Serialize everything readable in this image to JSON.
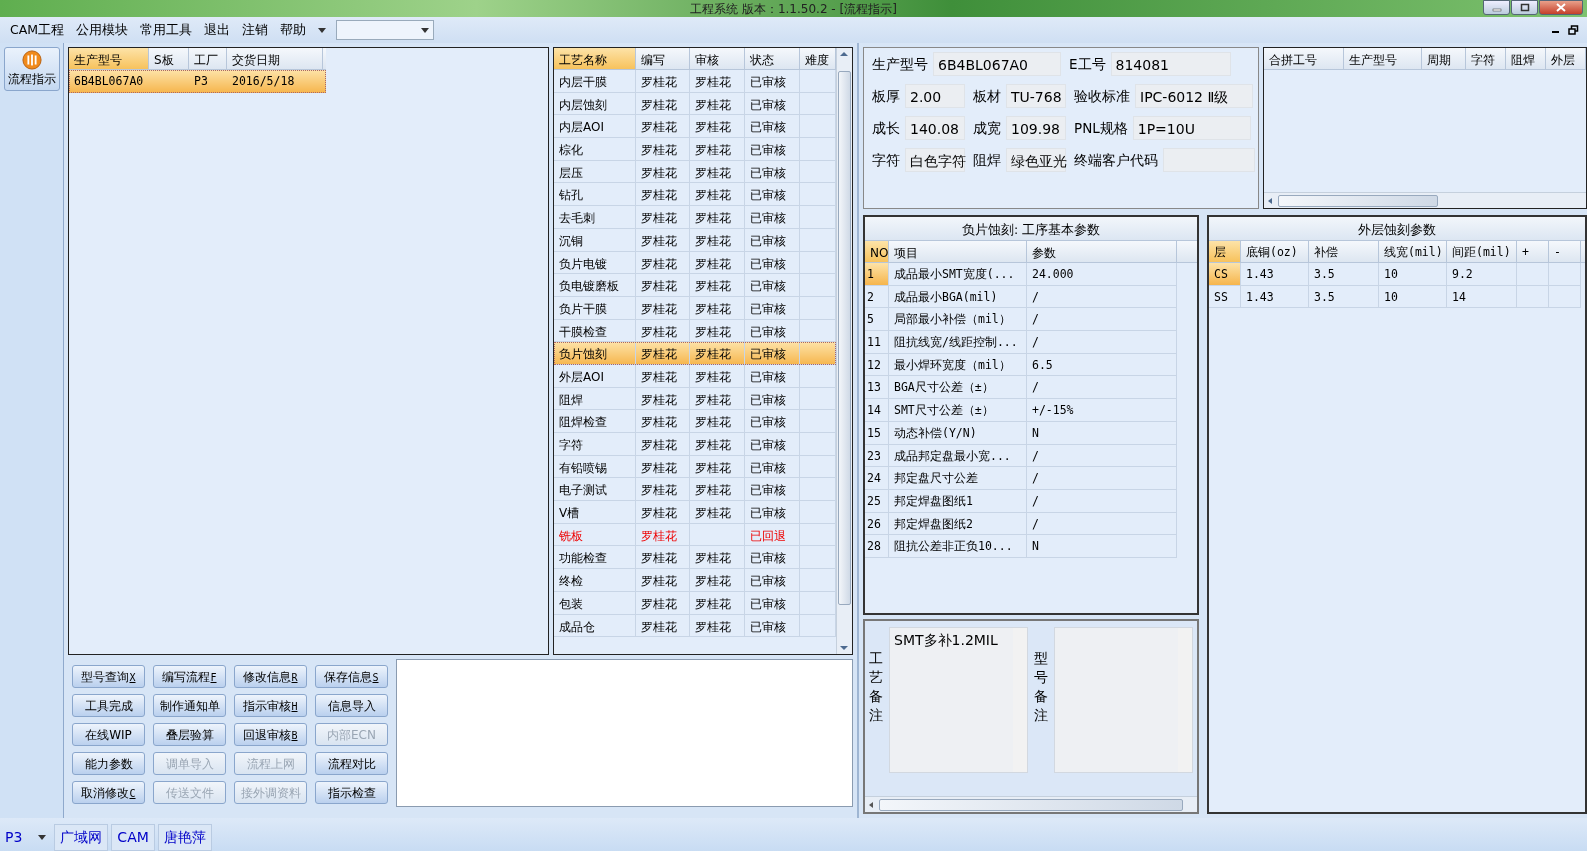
{
  "window": {
    "title": "工程系统   版本：1.1.50.2 - [流程指示]"
  },
  "menu": {
    "items": [
      "CAM工程",
      "公用模块",
      "常用工具",
      "退出",
      "注销",
      "帮助"
    ]
  },
  "sidebar": {
    "button": "流程指示"
  },
  "model_list": {
    "columns": [
      "生产型号",
      "S板",
      "工厂",
      "交货日期"
    ],
    "rows": [
      {
        "model": "6B4BL067A0",
        "factory": "P3",
        "date": "2016/5/18",
        "selected": true
      }
    ]
  },
  "process_table": {
    "columns": [
      "工艺名称",
      "编写",
      "审核",
      "状态",
      "难度"
    ],
    "rows": [
      {
        "name": "内层干膜",
        "writer": "罗桂花",
        "reviewer": "罗桂花",
        "status": "已审核",
        "selected": false,
        "rejected": false
      },
      {
        "name": "内层蚀刻",
        "writer": "罗桂花",
        "reviewer": "罗桂花",
        "status": "已审核",
        "selected": false,
        "rejected": false
      },
      {
        "name": "内层AOI",
        "writer": "罗桂花",
        "reviewer": "罗桂花",
        "status": "已审核",
        "selected": false,
        "rejected": false
      },
      {
        "name": "棕化",
        "writer": "罗桂花",
        "reviewer": "罗桂花",
        "status": "已审核",
        "selected": false,
        "rejected": false
      },
      {
        "name": "层压",
        "writer": "罗桂花",
        "reviewer": "罗桂花",
        "status": "已审核",
        "selected": false,
        "rejected": false
      },
      {
        "name": "钻孔",
        "writer": "罗桂花",
        "reviewer": "罗桂花",
        "status": "已审核",
        "selected": false,
        "rejected": false
      },
      {
        "name": "去毛刺",
        "writer": "罗桂花",
        "reviewer": "罗桂花",
        "status": "已审核",
        "selected": false,
        "rejected": false
      },
      {
        "name": "沉铜",
        "writer": "罗桂花",
        "reviewer": "罗桂花",
        "status": "已审核",
        "selected": false,
        "rejected": false
      },
      {
        "name": "负片电镀",
        "writer": "罗桂花",
        "reviewer": "罗桂花",
        "status": "已审核",
        "selected": false,
        "rejected": false
      },
      {
        "name": "负电镀磨板",
        "writer": "罗桂花",
        "reviewer": "罗桂花",
        "status": "已审核",
        "selected": false,
        "rejected": false
      },
      {
        "name": "负片干膜",
        "writer": "罗桂花",
        "reviewer": "罗桂花",
        "status": "已审核",
        "selected": false,
        "rejected": false
      },
      {
        "name": "干膜检查",
        "writer": "罗桂花",
        "reviewer": "罗桂花",
        "status": "已审核",
        "selected": false,
        "rejected": false
      },
      {
        "name": "负片蚀刻",
        "writer": "罗桂花",
        "reviewer": "罗桂花",
        "status": "已审核",
        "selected": true,
        "rejected": false
      },
      {
        "name": "外层AOI",
        "writer": "罗桂花",
        "reviewer": "罗桂花",
        "status": "已审核",
        "selected": false,
        "rejected": false
      },
      {
        "name": "阻焊",
        "writer": "罗桂花",
        "reviewer": "罗桂花",
        "status": "已审核",
        "selected": false,
        "rejected": false
      },
      {
        "name": "阻焊检查",
        "writer": "罗桂花",
        "reviewer": "罗桂花",
        "status": "已审核",
        "selected": false,
        "rejected": false
      },
      {
        "name": "字符",
        "writer": "罗桂花",
        "reviewer": "罗桂花",
        "status": "已审核",
        "selected": false,
        "rejected": false
      },
      {
        "name": "有铅喷锡",
        "writer": "罗桂花",
        "reviewer": "罗桂花",
        "status": "已审核",
        "selected": false,
        "rejected": false
      },
      {
        "name": "电子测试",
        "writer": "罗桂花",
        "reviewer": "罗桂花",
        "status": "已审核",
        "selected": false,
        "rejected": false
      },
      {
        "name": "V槽",
        "writer": "罗桂花",
        "reviewer": "罗桂花",
        "status": "已审核",
        "selected": false,
        "rejected": false
      },
      {
        "name": "铣板",
        "writer": "罗桂花",
        "status": "已回退",
        "selected": false,
        "rejected": true
      },
      {
        "name": "功能检查",
        "writer": "罗桂花",
        "reviewer": "罗桂花",
        "status": "已审核",
        "selected": false,
        "rejected": false
      },
      {
        "name": "终检",
        "writer": "罗桂花",
        "reviewer": "罗桂花",
        "status": "已审核",
        "selected": false,
        "rejected": false
      },
      {
        "name": "包装",
        "writer": "罗桂花",
        "reviewer": "罗桂花",
        "status": "已审核",
        "selected": false,
        "rejected": false
      },
      {
        "name": "成品仓",
        "writer": "罗桂花",
        "reviewer": "罗桂花",
        "status": "已审核",
        "selected": false,
        "rejected": false
      }
    ]
  },
  "actions": [
    {
      "label": "型号查询",
      "shortcut": "X",
      "disabled": false
    },
    {
      "label": "编写流程",
      "shortcut": "F",
      "disabled": false
    },
    {
      "label": "修改信息",
      "shortcut": "R",
      "disabled": false
    },
    {
      "label": "保存信息",
      "shortcut": "S",
      "disabled": false
    },
    {
      "label": "工具完成",
      "disabled": false
    },
    {
      "label": "制作通知单",
      "disabled": false
    },
    {
      "label": "指示审核",
      "shortcut": "H",
      "disabled": false
    },
    {
      "label": "信息导入",
      "disabled": false
    },
    {
      "label": "在线WIP",
      "disabled": false
    },
    {
      "label": "叠层验算",
      "disabled": false
    },
    {
      "label": "回退审核",
      "shortcut": "B",
      "disabled": false
    },
    {
      "label": "内部ECN",
      "disabled": true
    },
    {
      "label": "能力参数",
      "disabled": false
    },
    {
      "label": "调单导入",
      "disabled": true
    },
    {
      "label": "流程上网",
      "disabled": true
    },
    {
      "label": "流程对比",
      "disabled": false
    },
    {
      "label": "取消修改",
      "shortcut": "C",
      "disabled": false
    },
    {
      "label": "传送文件",
      "disabled": true
    },
    {
      "label": "接外调资料",
      "disabled": true
    },
    {
      "label": "指示检查",
      "disabled": false
    }
  ],
  "info": {
    "rows": [
      {
        "fields": [
          {
            "label": "生产型号",
            "value": "6B4BL067A0"
          },
          {
            "label": "E工号",
            "value": "814081"
          }
        ]
      },
      {
        "fields": [
          {
            "label": "板厚",
            "value": "2.00"
          },
          {
            "label": "板材",
            "value": "TU-768"
          },
          {
            "label": "验收标准",
            "value": "IPC-6012 Ⅱ级"
          }
        ]
      },
      {
        "fields": [
          {
            "label": "成长",
            "value": "140.08"
          },
          {
            "label": "成宽",
            "value": "109.98"
          },
          {
            "label": "PNL规格",
            "value": "1P=10U"
          }
        ]
      },
      {
        "fields": [
          {
            "label": "字符",
            "value": "白色字符"
          },
          {
            "label": "阻焊",
            "value": "绿色亚光"
          },
          {
            "label": "终端客户代码"
          }
        ]
      }
    ]
  },
  "combine_list": {
    "columns": [
      "合拼工号",
      "生产型号",
      "周期",
      "字符",
      "阻焊",
      "外层"
    ]
  },
  "process_params": {
    "title": "负片蚀刻: 工序基本参数",
    "columns": [
      "NO",
      "项目",
      "参数"
    ],
    "rows": [
      {
        "no": "1",
        "item": "成品最小SMT宽度(...",
        "value": "24.000",
        "selected": true
      },
      {
        "no": "2",
        "item": "成品最小BGA(mil)",
        "value": "/",
        "selected": false
      },
      {
        "no": "5",
        "item": "局部最小补偿（mil）",
        "value": "/",
        "selected": false
      },
      {
        "no": "11",
        "item": "阻抗线宽/线距控制...",
        "value": "/",
        "selected": false
      },
      {
        "no": "12",
        "item": "最小焊环宽度（mil）",
        "value": "6.5",
        "selected": false
      },
      {
        "no": "13",
        "item": "BGA尺寸公差（±）",
        "value": "/",
        "selected": false
      },
      {
        "no": "14",
        "item": "SMT尺寸公差（±）",
        "value": "+/-15%",
        "selected": false
      },
      {
        "no": "15",
        "item": "动态补偿(Y/N)",
        "value": "N",
        "selected": false
      },
      {
        "no": "23",
        "item": "成品邦定盘最小宽...",
        "value": "/",
        "selected": false
      },
      {
        "no": "24",
        "item": "邦定盘尺寸公差",
        "value": "/",
        "selected": false
      },
      {
        "no": "25",
        "item": "邦定焊盘图纸1",
        "value": "/",
        "selected": false
      },
      {
        "no": "26",
        "item": "邦定焊盘图纸2",
        "value": "/",
        "selected": false
      },
      {
        "no": "28",
        "item": "阻抗公差非正负10...",
        "value": "N",
        "selected": false
      }
    ]
  },
  "outer_params": {
    "title": "外层蚀刻参数",
    "columns": [
      "层",
      "底铜(oz)",
      "补偿",
      "线宽(mil)",
      "间距(mil)",
      "+",
      "-"
    ],
    "rows": [
      {
        "cells": [
          "CS",
          "1.43",
          "3.5",
          "10",
          "9.2"
        ],
        "selected": true
      },
      {
        "cells": [
          "SS",
          "1.43",
          "3.5",
          "10",
          "14"
        ],
        "selected": false
      }
    ]
  },
  "remarks": [
    {
      "label": "工艺备注",
      "value": "SMT多补1.2MIL"
    },
    {
      "label": "型号备注"
    }
  ],
  "status_bar": {
    "factory": "P3",
    "panels": [
      "广域网",
      "CAM",
      "唐艳萍"
    ]
  }
}
